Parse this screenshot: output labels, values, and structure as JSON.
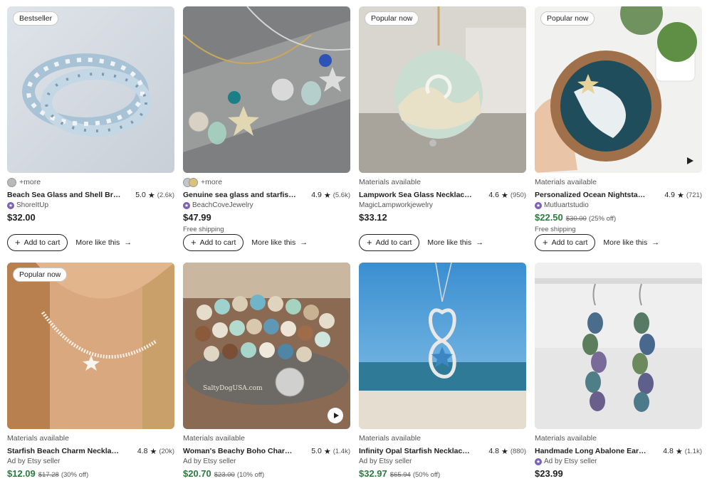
{
  "cards": [
    {
      "badge": "Bestseller",
      "line1": "+more",
      "title": "Beach Sea Glass and Shell Brace...",
      "rating": "5.0",
      "reviews": "(2.6k)",
      "shop": "ShoreItUp",
      "price": "$32.00",
      "cart_label": "Add to cart",
      "more_like": "More like this"
    },
    {
      "line1": "+more",
      "title": "Genuine sea glass and starfish n...",
      "rating": "4.9",
      "reviews": "(5.6k)",
      "shop": "BeachCoveJewelry",
      "price": "$47.99",
      "shipping": "Free shipping",
      "cart_label": "Add to cart",
      "more_like": "More like this"
    },
    {
      "badge": "Popular now",
      "line1": "Materials available",
      "title": "Lampwork Sea Glass Necklace, ...",
      "rating": "4.6",
      "reviews": "(950)",
      "shop": "MagicLampworkjewelry",
      "price": "$33.12",
      "cart_label": "Add to cart",
      "more_like": "More like this"
    },
    {
      "badge": "Popular now",
      "line1": "Materials available",
      "title": "Personalized Ocean Nightstand ...",
      "rating": "4.9",
      "reviews": "(721)",
      "shop": "Mutluartstudio",
      "price": "$22.50",
      "orig_price": "$30.00",
      "discount": "(25% off)",
      "shipping": "Free shipping",
      "cart_label": "Add to cart",
      "more_like": "More like this"
    },
    {
      "badge": "Popular now",
      "line1": "Materials available",
      "title": "Starfish Beach Charm Necklace ...",
      "rating": "4.8",
      "reviews": "(20k)",
      "shop": "Ad by Etsy seller",
      "price": "$12.09",
      "orig_price": "$17.28",
      "discount": "(30% off)"
    },
    {
      "line1": "Materials available",
      "title": "Woman's Beachy Boho Charm Br...",
      "rating": "5.0",
      "reviews": "(1.4k)",
      "shop": "Ad by Etsy seller",
      "price": "$20.70",
      "orig_price": "$23.00",
      "discount": "(10% off)",
      "image_text": "SaltyDogUSA.com"
    },
    {
      "line1": "Materials available",
      "title": "Infinity Opal Starfish Necklace - ...",
      "rating": "4.8",
      "reviews": "(880)",
      "shop": "Ad by Etsy seller",
      "price": "$32.97",
      "orig_price": "$65.94",
      "discount": "(50% off)"
    },
    {
      "line1": "Materials available",
      "title": "Handmade Long Abalone Earrin...",
      "rating": "4.8",
      "reviews": "(1.1k)",
      "shop": "Ad by Etsy seller",
      "price": "$23.99"
    }
  ],
  "icons": {
    "star": "star-icon",
    "plus": "plus-icon",
    "arrow": "arrow-right-icon",
    "play": "play-icon",
    "shop": "star-seller-icon"
  },
  "colors": {
    "sale_price": "#2b7a3d",
    "star_seller": "#7a5fb5"
  }
}
